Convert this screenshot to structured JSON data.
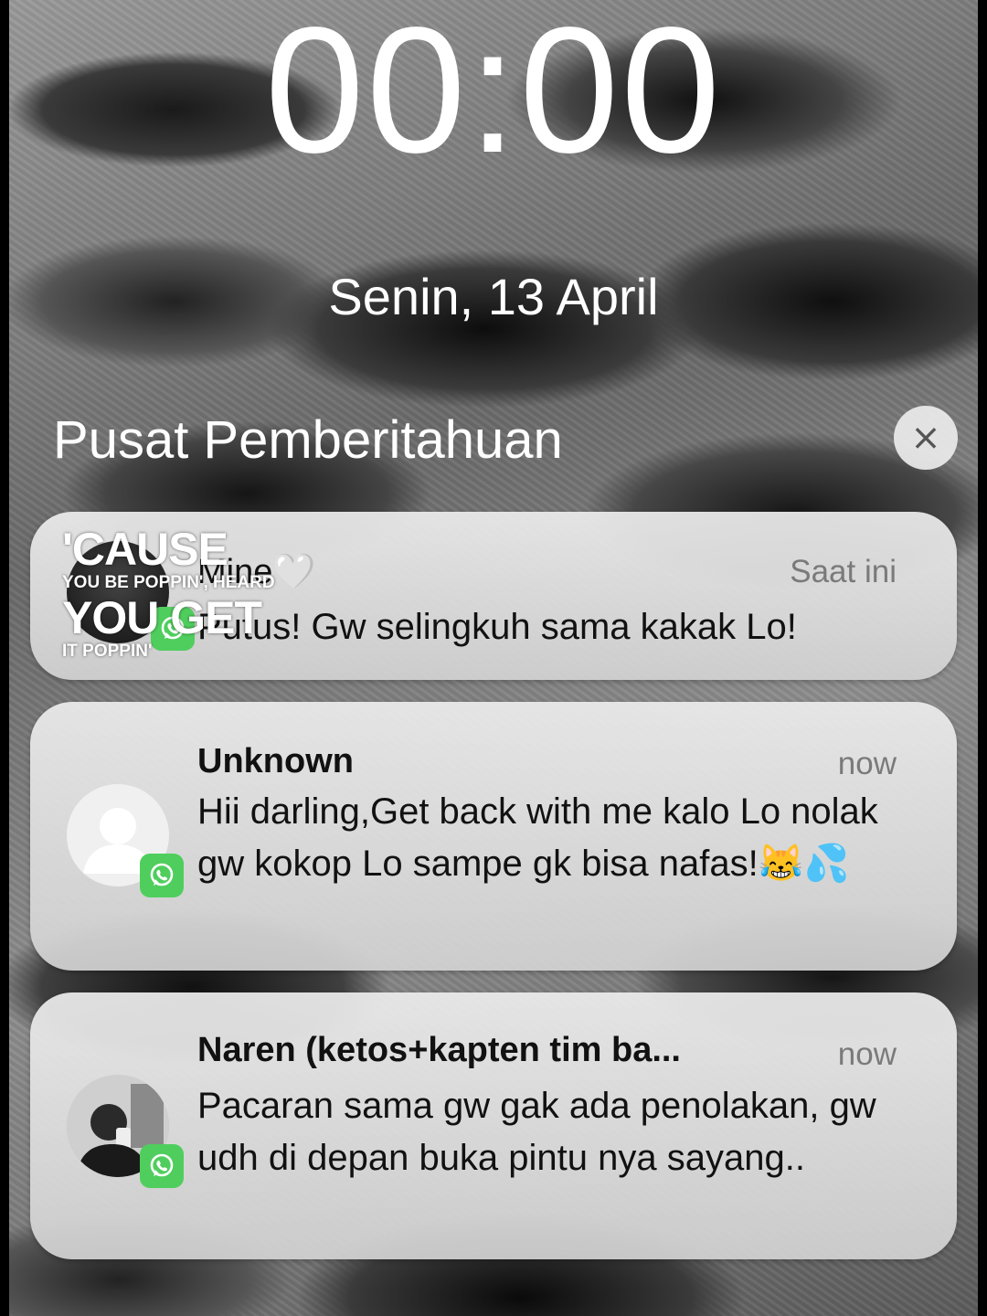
{
  "lockscreen": {
    "time": "00:00",
    "date": "Senin, 13 April"
  },
  "notification_center": {
    "title": "Pusat Pemberitahuan",
    "close_glyph": "×"
  },
  "notifications": [
    {
      "sender": "Mine🤍",
      "time": "Saat ini",
      "message": "Putus! Gw selingkuh sama kakak Lo!",
      "app_icon": "whatsapp-icon"
    },
    {
      "sender": "Unknown",
      "time": "now",
      "message": "Hii darling,Get back with me kalo Lo nolak gw kokop Lo sampe gk bisa nafas!😹💦",
      "app_icon": "whatsapp-icon"
    },
    {
      "sender": "Naren (ketos+kapten tim ba...",
      "time": "now",
      "message": "Pacaran sama gw gak ada penolakan, gw udh di depan buka pintu nya sayang..",
      "app_icon": "whatsapp-icon"
    }
  ],
  "sticker": {
    "line1": "'CAUSE",
    "line2": "YOU BE POPPIN', HEARD",
    "line3": "YOU GET",
    "line4": "IT POPPIN'"
  },
  "colors": {
    "whatsapp": "#4fce5d",
    "card": "#e6e6e6",
    "time_text": "#7a7a7a"
  }
}
